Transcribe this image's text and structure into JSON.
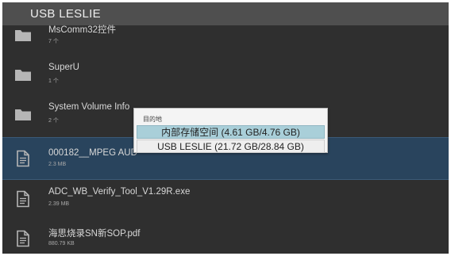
{
  "header": {
    "title": "USB LESLIE"
  },
  "files": [
    {
      "name": "MsComm32控件",
      "meta": "7 个",
      "icon": "folder-icon",
      "type": "folder"
    },
    {
      "name": "SuperU",
      "meta": "1 个",
      "icon": "folder-icon",
      "type": "folder"
    },
    {
      "name": "System Volume Info",
      "meta": "2 个",
      "icon": "folder-icon",
      "type": "folder"
    },
    {
      "name": "000182__MPEG AUD",
      "meta": "2.3 MB",
      "icon": "file-icon",
      "type": "file",
      "selected": true
    },
    {
      "name": "ADC_WB_Verify_Tool_V1.29R.exe",
      "meta": "2.39 MB",
      "icon": "file-icon",
      "type": "file"
    },
    {
      "name": "海思烧录SN新SOP.pdf",
      "meta": "880.79 KB",
      "icon": "file-icon",
      "type": "file"
    }
  ],
  "dialog": {
    "title": "目的地",
    "options": [
      {
        "label": "内部存储空间 (4.61 GB/4.76 GB)",
        "highlighted": true
      },
      {
        "label": "USB LESLIE (21.72 GB/28.84 GB)",
        "highlighted": false
      }
    ]
  },
  "colors": {
    "background": "#2f2f2f",
    "title_bar": "#4f4f4f",
    "selected_row": "#29445d",
    "dialog_highlight": "#a9cfd9"
  }
}
